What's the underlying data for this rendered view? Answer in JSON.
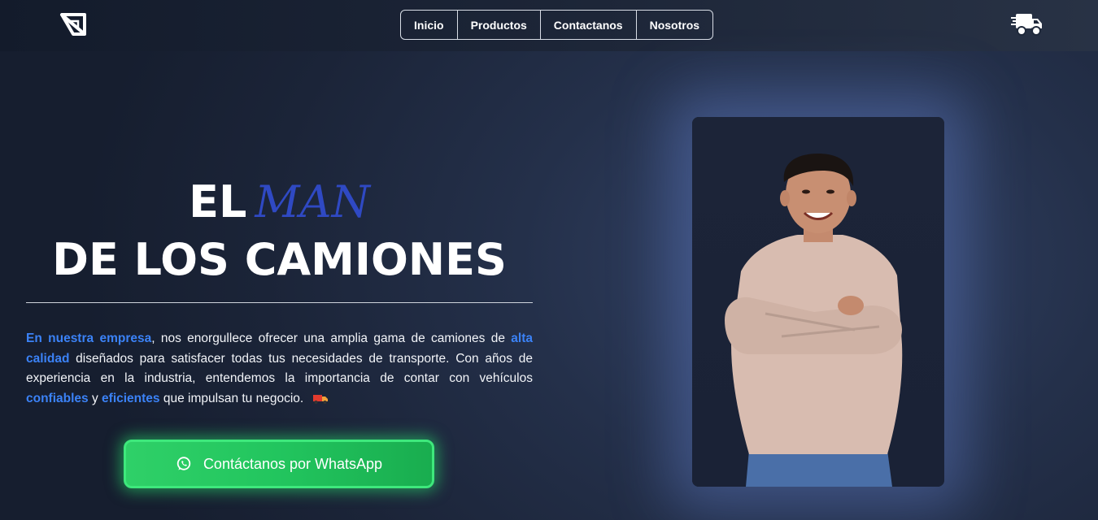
{
  "header": {
    "nav": [
      {
        "label": "Inicio"
      },
      {
        "label": "Productos"
      },
      {
        "label": "Contactanos"
      },
      {
        "label": "Nosotros"
      }
    ],
    "logo_icon": "triangle-logo-icon",
    "cart_icon": "delivery-truck-icon"
  },
  "hero": {
    "title_el": "EL",
    "title_man": "MAN",
    "title_line2": "DE LOS CAMIONES",
    "description": {
      "p1_hl": "En nuestra empresa",
      "p2": ", nos enorgullece ofrecer una amplia gama de camiones de ",
      "p3_hl": "alta calidad",
      "p4": " diseñados para satisfacer todas tus necesidades de transporte. Con años de experiencia en la industria, entendemos la importancia de contar con vehículos ",
      "p5_hl": "confiables",
      "p6": " y ",
      "p7_hl": "eficientes",
      "p8": " que impulsan tu negocio."
    },
    "whatsapp_button": "Contáctanos por WhatsApp"
  },
  "colors": {
    "accent_blue": "#3b82f6",
    "man_blue": "#2f49c3",
    "whatsapp_green": "#22c55e"
  }
}
